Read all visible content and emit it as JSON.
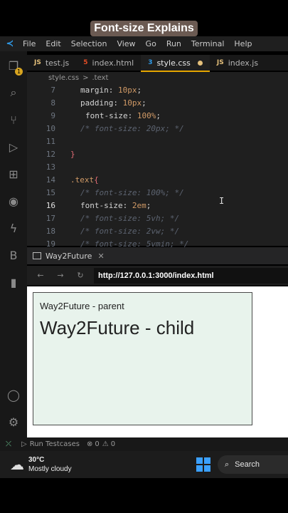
{
  "banner": {
    "title": "Font-size Explains"
  },
  "menu": [
    "File",
    "Edit",
    "Selection",
    "View",
    "Go",
    "Run",
    "Terminal",
    "Help"
  ],
  "activity_badge": "1",
  "tabs": [
    {
      "icon": "JS",
      "label": "test.js",
      "color": "#e5c07b"
    },
    {
      "icon": "5",
      "label": "index.html",
      "color": "#e44d26"
    },
    {
      "icon": "3",
      "label": "style.css",
      "color": "#2f9ae8"
    },
    {
      "icon": "JS",
      "label": "index.js",
      "color": "#e5c07b"
    }
  ],
  "breadcrumb": {
    "file": "style.css",
    "sep": ">",
    "symbol": ".text"
  },
  "code": {
    "l7": {
      "n": "7",
      "prop": "margin",
      "val": "10",
      "unit": "px"
    },
    "l8": {
      "n": "8",
      "prop": "padding",
      "val": "10",
      "unit": "px"
    },
    "l9": {
      "n": "9",
      "prop": "font-size",
      "val": "100",
      "unit": "%"
    },
    "l10": {
      "n": "10",
      "comment": "/* font-size: 20px; */"
    },
    "l11": {
      "n": "11"
    },
    "l12": {
      "n": "12",
      "brace": "}"
    },
    "l13": {
      "n": "13"
    },
    "l14": {
      "n": "14",
      "selector": ".text",
      "brace": "{"
    },
    "l15": {
      "n": "15",
      "comment": "/* font-size: 100%; */"
    },
    "l16": {
      "n": "16",
      "prop": "font-size",
      "val": "2",
      "unit": "em"
    },
    "l17": {
      "n": "17",
      "comment": "/* font-size: 5vh; */"
    },
    "l18": {
      "n": "18",
      "comment": "/* font-size: 2vw; */"
    },
    "l19": {
      "n": "19",
      "comment": "/* font-size: 5vmin; */"
    }
  },
  "browser": {
    "tab_label": "Way2Future",
    "url": "http://127.0.0.1:3000/index.html",
    "parent_text": "Way2Future - parent",
    "child_text": "Way2Future - child"
  },
  "status": {
    "run": "Run Testcases",
    "errors": "0",
    "warnings": "0"
  },
  "taskbar": {
    "temp": "30°C",
    "condition": "Mostly cloudy",
    "search": "Search"
  }
}
